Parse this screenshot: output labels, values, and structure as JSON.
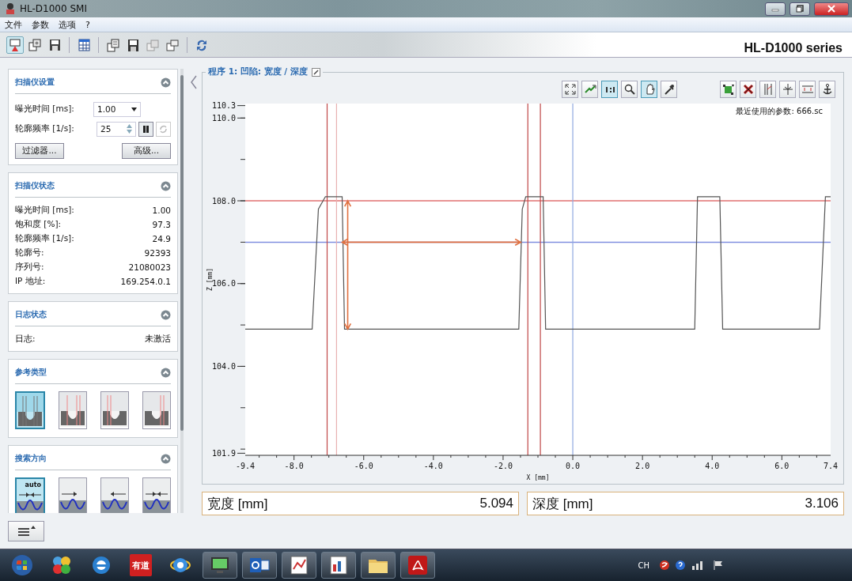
{
  "window": {
    "title": "HL-D1000 SMI"
  },
  "menu": [
    "文件",
    "参数",
    "选项",
    "?"
  ],
  "toolbar": {
    "buttons": [
      {
        "kind": "scanner",
        "selected": true
      },
      {
        "kind": "open-config",
        "selected": false
      },
      {
        "kind": "save-config",
        "selected": false
      },
      {
        "kind": "sep"
      },
      {
        "kind": "table",
        "selected": false
      },
      {
        "kind": "sep"
      },
      {
        "kind": "open-profile",
        "selected": false
      },
      {
        "kind": "save-profile",
        "selected": false
      },
      {
        "kind": "export",
        "selected": false
      },
      {
        "kind": "import",
        "selected": false
      },
      {
        "kind": "sep"
      },
      {
        "kind": "refresh",
        "selected": false
      }
    ],
    "brand": "HL-D1000 series"
  },
  "panels": [
    {
      "kind": "settings",
      "title": "扫描仪设置",
      "expanded": true,
      "exposure": {
        "label": "曝光时间 [ms]:",
        "value": "1.00"
      },
      "frequency": {
        "label": "轮廓频率 [1/s]:",
        "value": "25"
      },
      "buttons": [
        "过滤器...",
        "高级..."
      ]
    },
    {
      "kind": "status",
      "title": "扫描仪状态",
      "expanded": true,
      "rows": [
        {
          "label": "曝光时间 [ms]:",
          "value": "1.00"
        },
        {
          "label": "饱和度 [%]:",
          "value": "97.3"
        },
        {
          "label": "轮廓频率 [1/s]:",
          "value": "24.9"
        },
        {
          "label": "轮廓号:",
          "value": "92393"
        },
        {
          "label": "序列号:",
          "value": "21080023"
        },
        {
          "label": "IP 地址:",
          "value": "169.254.0.1"
        }
      ]
    },
    {
      "kind": "status",
      "title": "日志状态",
      "expanded": true,
      "rows": [
        {
          "label": "日志:",
          "value": "未激活"
        }
      ]
    },
    {
      "kind": "reference",
      "title": "参考类型",
      "expanded": true,
      "tiles": [
        {
          "kind": "both",
          "selected": true
        },
        {
          "kind": "center",
          "selected": false
        },
        {
          "kind": "left",
          "selected": false
        },
        {
          "kind": "right",
          "selected": false
        }
      ]
    },
    {
      "kind": "direction",
      "title": "搜索方向",
      "expanded": true,
      "tiles": [
        {
          "kind": "auto",
          "label": "auto",
          "selected": true
        },
        {
          "kind": "right",
          "selected": false
        },
        {
          "kind": "left",
          "selected": false
        },
        {
          "kind": "inward",
          "selected": false
        }
      ]
    }
  ],
  "program": {
    "title": "程序 1: 凹陷: 宽度 / 深度",
    "tools": [
      {
        "kind": "fit",
        "selected": false
      },
      {
        "kind": "autoscale",
        "selected": false
      },
      {
        "kind": "ratio",
        "selected": true
      },
      {
        "kind": "zoom",
        "selected": false
      },
      {
        "kind": "pan",
        "selected": true
      },
      {
        "kind": "picker",
        "selected": false
      }
    ],
    "tools2": [
      {
        "kind": "add",
        "selected": false
      },
      {
        "kind": "delete",
        "selected": false
      },
      {
        "kind": "vlines",
        "selected": false
      },
      {
        "kind": "cursor",
        "selected": false
      },
      {
        "kind": "hlines",
        "selected": false
      },
      {
        "kind": "anchor",
        "selected": false
      }
    ],
    "note": "最近使用的参数: 666.sc",
    "chart_data": {
      "type": "line",
      "xlabel": "X [mm]",
      "ylabel": "Z [mm]",
      "x": [
        -9.4,
        -7.48,
        -7.3,
        -7.1,
        -6.62,
        -6.55,
        -1.55,
        -1.45,
        -1.35,
        -0.85,
        -0.78,
        3.5,
        3.58,
        4.22,
        4.3,
        7.08,
        7.25,
        7.4
      ],
      "series": [
        {
          "color": "#555555",
          "values": [
            104.9,
            104.9,
            107.8,
            108.1,
            108.1,
            104.9,
            104.9,
            107.8,
            108.1,
            108.1,
            104.9,
            104.9,
            108.1,
            108.1,
            104.9,
            104.9,
            108.1,
            108.1
          ]
        }
      ],
      "xlim": [
        -9.4,
        7.4
      ],
      "ylim": [
        101.85,
        110.35
      ],
      "xticks": [
        -9.4,
        {
          "value": -8,
          "label": "-8.0"
        },
        {
          "value": -6,
          "label": "-6.0"
        },
        {
          "value": -4,
          "label": "-4.0"
        },
        {
          "value": -2,
          "label": "-2.0"
        },
        {
          "value": 0,
          "label": "0.0"
        },
        {
          "value": 2,
          "label": "2.0"
        },
        {
          "value": 4,
          "label": "4.0"
        },
        {
          "value": 6,
          "label": "6.0"
        },
        7.4
      ],
      "yticks": [
        110.3,
        {
          "value": 110,
          "label": "110.0"
        },
        {
          "value": 108,
          "label": "108.0"
        },
        {
          "value": 106,
          "label": "106.0"
        },
        {
          "value": 104,
          "label": "104.0"
        },
        101.9
      ],
      "ref_lines": [
        {
          "axis": "y",
          "value": 108.0,
          "color": "#e07070"
        },
        {
          "axis": "y",
          "value": 107.0,
          "color": "#8090e0"
        },
        {
          "axis": "x",
          "value": -7.05,
          "color": "#c04848"
        },
        {
          "axis": "x",
          "value": -6.78,
          "color": "#e8b0b0"
        },
        {
          "axis": "x",
          "value": -1.29,
          "color": "#c04848"
        },
        {
          "axis": "x",
          "value": -0.93,
          "color": "#c04848"
        },
        {
          "axis": "x",
          "value": 0,
          "color": "#90a8e0"
        }
      ]
    }
  },
  "measurements": [
    {
      "label": "宽度 [mm]",
      "value": "5.094"
    },
    {
      "label": "深度 [mm]",
      "value": "3.106"
    }
  ],
  "taskbar": {
    "apps": [
      {
        "kind": "start"
      },
      {
        "kind": "pinwheel"
      },
      {
        "kind": "ie"
      },
      {
        "kind": "dict",
        "label": "有道"
      },
      {
        "kind": "ie-alt"
      },
      {
        "kind": "monitor"
      },
      {
        "kind": "mail"
      },
      {
        "kind": "chart-app"
      },
      {
        "kind": "chart-app2"
      },
      {
        "kind": "folder"
      },
      {
        "kind": "pdf"
      }
    ],
    "language": "CH"
  }
}
